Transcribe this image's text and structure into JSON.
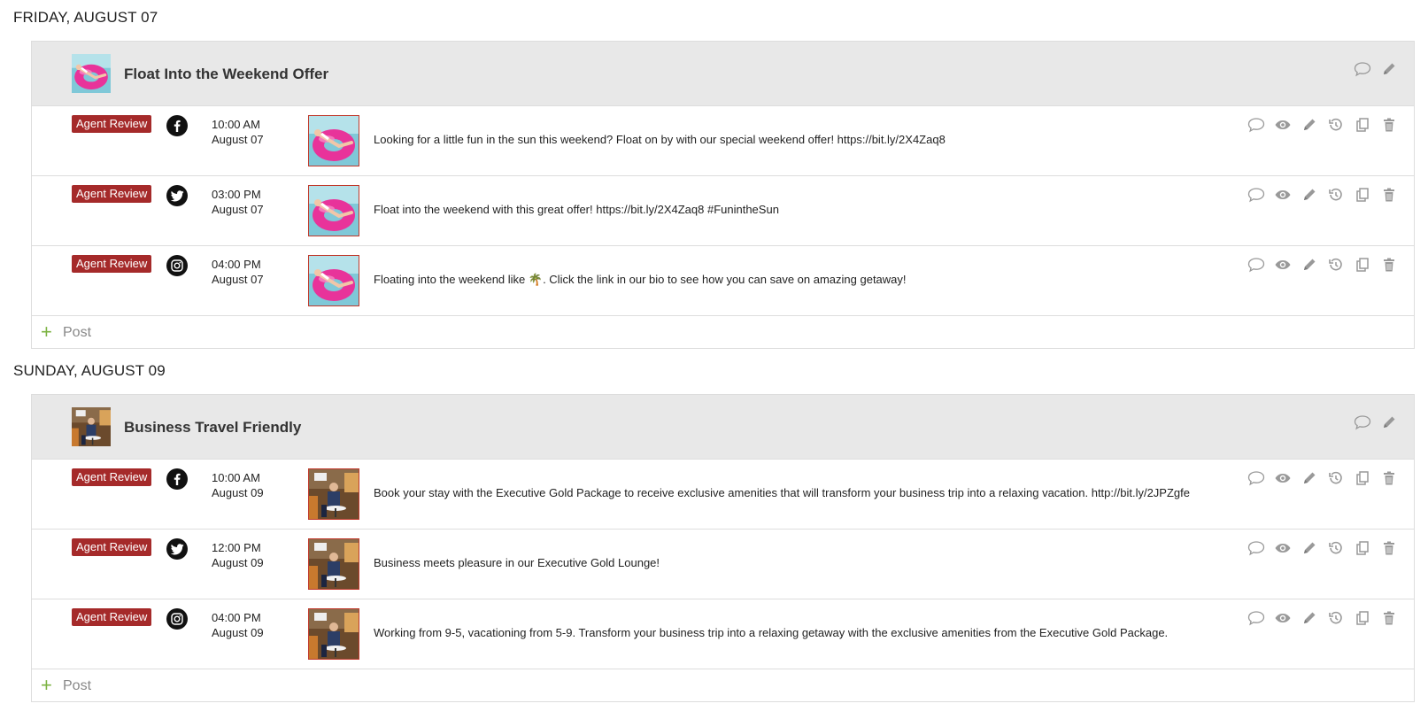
{
  "days": [
    {
      "label": "FRIDAY, AUGUST 07",
      "campaign": {
        "title": "Float Into the Weekend Offer",
        "image": "pink-float-image"
      },
      "posts": [
        {
          "status": "Agent Review",
          "network": "facebook",
          "time": "10:00 AM",
          "date": "August 07",
          "image": "pink-float-image",
          "text": "Looking for a little fun in the sun this weekend? Float on by with our special weekend offer! https://bit.ly/2X4Zaq8"
        },
        {
          "status": "Agent Review",
          "network": "twitter",
          "time": "03:00 PM",
          "date": "August 07",
          "image": "pink-float-image",
          "text": "Float into the weekend with this great offer! https://bit.ly/2X4Zaq8 #FunintheSun"
        },
        {
          "status": "Agent Review",
          "network": "instagram",
          "time": "04:00 PM",
          "date": "August 07",
          "image": "pink-float-image",
          "text": "Floating into the weekend like 🌴. Click the link in our bio to see how you can save on amazing getaway!"
        }
      ],
      "add_label": "Post"
    },
    {
      "label": "SUNDAY, AUGUST 09",
      "campaign": {
        "title": "Business Travel Friendly",
        "image": "business-lounge-image"
      },
      "posts": [
        {
          "status": "Agent Review",
          "network": "facebook",
          "time": "10:00 AM",
          "date": "August 09",
          "image": "business-lounge-image",
          "text": "Book your stay with the Executive Gold Package to receive exclusive amenities that will transform your business trip into a relaxing vacation. http://bit.ly/2JPZgfe"
        },
        {
          "status": "Agent Review",
          "network": "twitter",
          "time": "12:00 PM",
          "date": "August 09",
          "image": "business-lounge-image",
          "text": "Business meets pleasure in our Executive Gold Lounge!"
        },
        {
          "status": "Agent Review",
          "network": "instagram",
          "time": "04:00 PM",
          "date": "August 09",
          "image": "business-lounge-image",
          "text": "Working from 9-5, vacationing from 5-9. Transform your business trip into a relaxing getaway with the exclusive amenities from the Executive Gold Package."
        }
      ],
      "add_label": "Post"
    }
  ],
  "row_action_icons": [
    "comment-icon",
    "eye-icon",
    "pencil-icon",
    "history-icon",
    "duplicate-icon",
    "trash-icon"
  ],
  "campaign_action_icons": [
    "comment-icon",
    "pencil-icon"
  ],
  "colors": {
    "badge": "#a52a2a",
    "header_bg": "#e8e8e8",
    "plus": "#7cb342",
    "thumb_border": "#c0392b"
  }
}
